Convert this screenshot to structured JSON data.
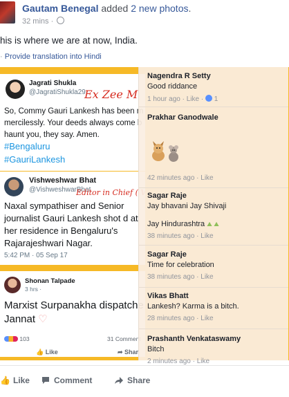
{
  "header": {
    "author": "Gautam Benegal",
    "action_prefix": "added",
    "action_link": "2 new photos",
    "action_suffix": ".",
    "time": "32 mins"
  },
  "post": {
    "text": "his is where we are at now, India.",
    "translate": "Provide translation into Hindi"
  },
  "photo": {
    "tweet1": {
      "name": "Jagrati Shukla",
      "handle": "@JagratiShukla29",
      "overlay": "Ex Zee M",
      "body": "So, Commy Gauri Lankesh has been m mercilessly. Your deeds always come b haunt you, they say. Amen.",
      "tag1": "#Bengaluru",
      "tag2": "#GauriLankesh"
    },
    "tweet2": {
      "name": "Vishweshwar Bhat",
      "handle": "@VishweshwarBhat",
      "overlay": "Editor in Chief ( Vi",
      "body": "Naxal sympathiser and Senior journalist Gauri Lankesh shot d at her residence in Bengaluru's Rajarajeshwari Nagar.",
      "time": "5:42 PM · 05 Sep 17"
    },
    "tweet3": {
      "name": "Shonan Talpade",
      "meta": "3 hrs ·",
      "body": "Marxist Surpanakha dispatche Jannat",
      "reactions": "103",
      "comments": "31 Comment",
      "like": "Like",
      "share": "Shar"
    }
  },
  "comments": [
    {
      "name": "Nagendra R Setty",
      "text": "Good riddance",
      "meta": "1 hour ago · Like ·",
      "likes": "1"
    },
    {
      "name": "Prakhar Ganodwale",
      "text": "",
      "meta": "42 minutes ago · Like"
    },
    {
      "name": "Sagar Raje",
      "text": "Jay bhavani Jay Shivaji",
      "text2": "Jay Hindurashtra",
      "meta": "38 minutes ago · Like"
    },
    {
      "name": "Sagar Raje",
      "text": "Time for celebration",
      "meta": "38 minutes ago · Like"
    },
    {
      "name": "Vikas Bhatt",
      "text": "Lankesh? Karma is a bitch.",
      "meta": "28 minutes ago · Like"
    },
    {
      "name": "Prashanth Venkataswamy",
      "text": "Bitch",
      "meta": "2 minutes ago · Like"
    }
  ],
  "actions": {
    "like": "Like",
    "comment": "Comment",
    "share": "Share"
  },
  "colors": {
    "link": "#365899",
    "photo_bg": "#f6b926",
    "overlay_bg": "#faeee2"
  }
}
